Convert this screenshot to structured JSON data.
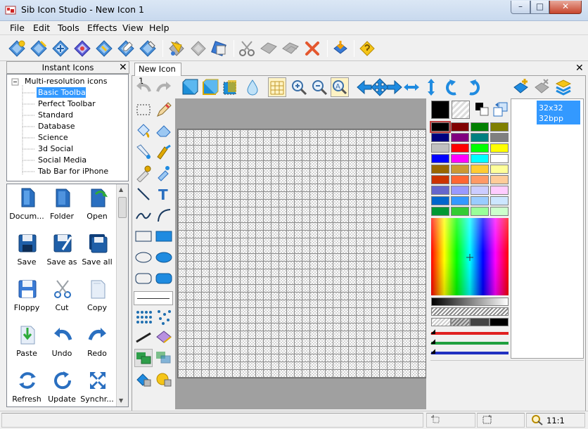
{
  "window": {
    "title": "Sib Icon Studio - New Icon 1",
    "minimize": "–",
    "maximize": "□",
    "close": "✕"
  },
  "menu": [
    "File",
    "Edit",
    "Tools",
    "Effects",
    "View",
    "Help"
  ],
  "toolbar": {
    "icons": [
      "new-icon",
      "new-image-icon",
      "open-icon",
      "save-icon",
      "save-as-icon",
      "save-all-icon",
      "export-icon",
      "undo-effect-icon",
      "select-icon",
      "gallery-icon",
      "tool-icon",
      "cut-icon",
      "copy-icon",
      "paste-icon",
      "delete-icon",
      "import-icon",
      "help-icon"
    ]
  },
  "instant_icons": {
    "header": "Instant Icons",
    "close": "✕",
    "tree_root": "Multi-resolution icons",
    "tree_items": [
      "Basic Toolbar",
      "Perfect Toolbar",
      "Standard",
      "Database",
      "Science",
      "3d Social",
      "Social Media",
      "Tab Bar for iPhone"
    ],
    "selected_index": 0
  },
  "tiles": [
    {
      "label": "Docum...",
      "icon": "document-icon"
    },
    {
      "label": "Folder",
      "icon": "folder-icon"
    },
    {
      "label": "Open",
      "icon": "open-icon"
    },
    {
      "label": "Save",
      "icon": "save-icon"
    },
    {
      "label": "Save as",
      "icon": "save-as-icon"
    },
    {
      "label": "Save all",
      "icon": "save-all-icon"
    },
    {
      "label": "Floppy",
      "icon": "floppy-icon"
    },
    {
      "label": "Cut",
      "icon": "cut-icon"
    },
    {
      "label": "Copy",
      "icon": "copy-icon"
    },
    {
      "label": "Paste",
      "icon": "paste-icon"
    },
    {
      "label": "Undo",
      "icon": "undo-icon"
    },
    {
      "label": "Redo",
      "icon": "redo-icon"
    },
    {
      "label": "Refresh",
      "icon": "refresh-icon"
    },
    {
      "label": "Update",
      "icon": "update-icon"
    },
    {
      "label": "Synchr...",
      "icon": "synchronize-icon"
    }
  ],
  "document": {
    "tab": "New Icon 1",
    "close": "✕",
    "format_lines": [
      "32x32",
      "32bpp"
    ]
  },
  "status": {
    "zoom": "11:1"
  },
  "colors": {
    "accent": "#3399ff",
    "selection": "#3399ff",
    "palette": [
      [
        "#000000",
        "#800000",
        "#008000",
        "#808000"
      ],
      [
        "#000080",
        "#800080",
        "#008080",
        "#808080"
      ],
      [
        "#c0c0c0",
        "#ff0000",
        "#00ff00",
        "#ffff00"
      ],
      [
        "#0000ff",
        "#ff00ff",
        "#00ffff",
        "#ffffff"
      ],
      [
        "#996600",
        "#cc9933",
        "#ffcc33",
        "#ffff99"
      ],
      [
        "#cc3300",
        "#ff6633",
        "#ff9966",
        "#ffcc99"
      ],
      [
        "#6666cc",
        "#9999ff",
        "#ccccff",
        "#ffccff"
      ],
      [
        "#0066cc",
        "#3399ff",
        "#99ccff",
        "#cce6ff"
      ],
      [
        "#009933",
        "#33cc33",
        "#99ff99",
        "#ccffcc"
      ]
    ]
  }
}
